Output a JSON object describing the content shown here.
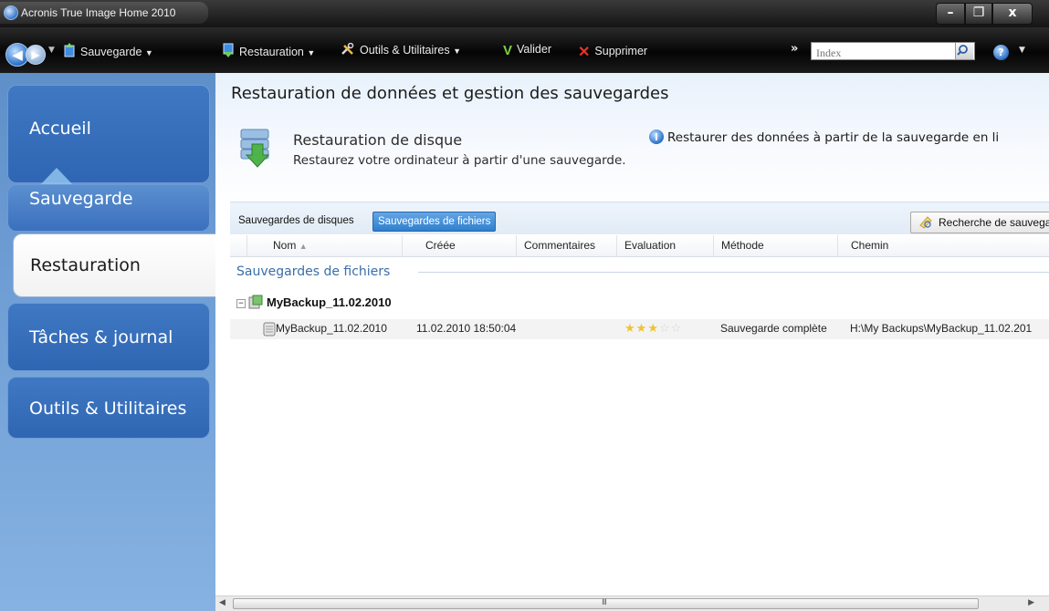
{
  "window": {
    "title": "Acronis True Image Home 2010",
    "controls": {
      "minimize": "–",
      "maximize": "❐",
      "close": "x"
    }
  },
  "toolbar": {
    "backup_menu": "Sauvegarde",
    "restore_menu": "Restauration",
    "tools_menu": "Outils & Utilitaires",
    "validate": "Valider",
    "delete": "Supprimer",
    "overflow": "»",
    "search_placeholder": "Index"
  },
  "sidebar": {
    "items": [
      {
        "label": "Accueil"
      },
      {
        "label": "Sauvegarde"
      },
      {
        "label": "Restauration",
        "active": true
      },
      {
        "label": "Tâches & journal"
      },
      {
        "label": "Outils & Utilitaires"
      }
    ]
  },
  "main": {
    "title": "Restauration de données et gestion des sauvegardes",
    "restore": {
      "title": "Restauration de disque",
      "description": "Restaurez votre ordinateur à partir d'une sauvegarde.",
      "link": "Restaurer des données à partir de la sauvegarde en li"
    },
    "tabs": [
      {
        "label": "Sauvegardes de disques",
        "active": false
      },
      {
        "label": "Sauvegardes de fichiers",
        "active": true
      }
    ],
    "search_backups": "Recherche de sauvegar",
    "columns": [
      "Nom",
      "Créée",
      "Commentaires",
      "Evaluation",
      "Méthode",
      "Chemin"
    ],
    "group_label": "Sauvegardes de fichiers",
    "tree_node": {
      "toggle": "−",
      "name": "MyBackup_11.02.2010"
    },
    "rows": [
      {
        "name": "MyBackup_11.02.2010",
        "created": "11.02.2010 18:50:04",
        "comments": "",
        "rating": 3,
        "rating_max": 5,
        "method": "Sauvegarde complète",
        "path": "H:\\My Backups\\MyBackup_11.02.201"
      }
    ]
  },
  "scrollbar": {
    "grip": "III"
  },
  "colors": {
    "sidebar_bg": "#6f9ed5",
    "sidebar_item": "#3a72bf",
    "active_tab": "#2f7fcf",
    "group_text": "#3a6ea8",
    "star": "#f2c230"
  }
}
